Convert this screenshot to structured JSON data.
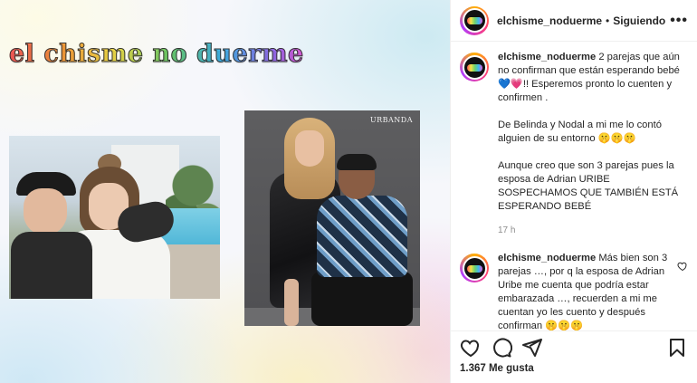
{
  "post_image": {
    "brand_title": "el chisme no duerme",
    "magazine_logo": "URBANDA"
  },
  "header": {
    "username": "elchisme_noduerme",
    "separator": "•",
    "follow_status": "Siguiendo",
    "more_icon": "more-options-icon"
  },
  "caption": {
    "username": "elchisme_noduerme",
    "paragraphs": [
      "2 parejas que aún no confirman que están esperando bebé 💙💗!! Esperemos pronto lo cuenten y confirmen .",
      "De Belinda y Nodal a mi me lo contó alguien de su entorno 🤫🤫🤫",
      "Aunque creo que son 3 parejas pues la esposa de Adrian URIBE SOSPECHAMOS QUE TAMBIÉN ESTÁ ESPERANDO BEBÉ"
    ],
    "time": "17 h"
  },
  "reply": {
    "username": "elchisme_noduerme",
    "text": "Más bien son 3 parejas …, por q la esposa de Adrian Uribe me cuenta que podría estar embarazada …, recuerden a mi me cuentan yo les cuento y después confirman 🤫🤫🤫",
    "like_icon": "heart-outline-icon"
  },
  "actions": {
    "icons": [
      "heart-icon",
      "comment-icon",
      "share-icon",
      "bookmark-icon"
    ]
  },
  "likes": {
    "count_text": "1.367 Me gusta"
  }
}
